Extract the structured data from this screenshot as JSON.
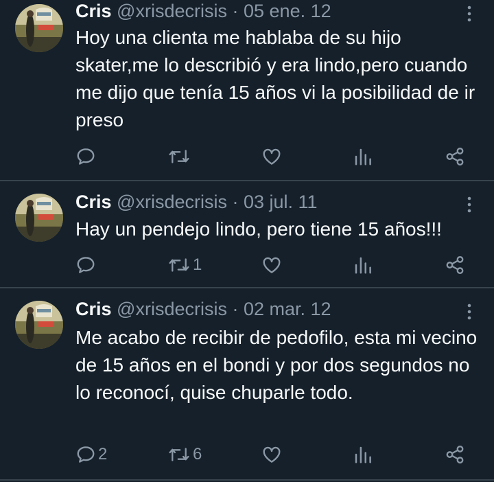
{
  "colors": {
    "background": "#15202b",
    "text": "#f7f9f9",
    "muted": "#8b98a5",
    "divider": "#38444d"
  },
  "icons": [
    "reply-icon",
    "retweet-icon",
    "like-icon",
    "views-icon",
    "share-icon",
    "more-icon"
  ],
  "tweets": [
    {
      "name": "Cris",
      "handle": "@xrisdecrisis",
      "separator": "·",
      "date": "05 ene. 12",
      "text": "Hoy una clienta me hablaba de su hijo skater,me lo describió y era lindo,pero cuando me dijo que tenía 15 años vi la posibilidad de ir preso",
      "replies": "",
      "retweets": ""
    },
    {
      "name": "Cris",
      "handle": "@xrisdecrisis",
      "separator": "·",
      "date": "03 jul. 11",
      "text": "Hay un pendejo lindo, pero tiene 15 años!!!",
      "replies": "",
      "retweets": "1"
    },
    {
      "name": "Cris",
      "handle": "@xrisdecrisis",
      "separator": "·",
      "date": "02 mar. 12",
      "text": "Me acabo de recibir de pedofilo, esta mi vecino de 15 años en el bondi y por dos segundos no lo reconocí, quise chuparle todo.",
      "replies": "2",
      "retweets": "6"
    }
  ]
}
